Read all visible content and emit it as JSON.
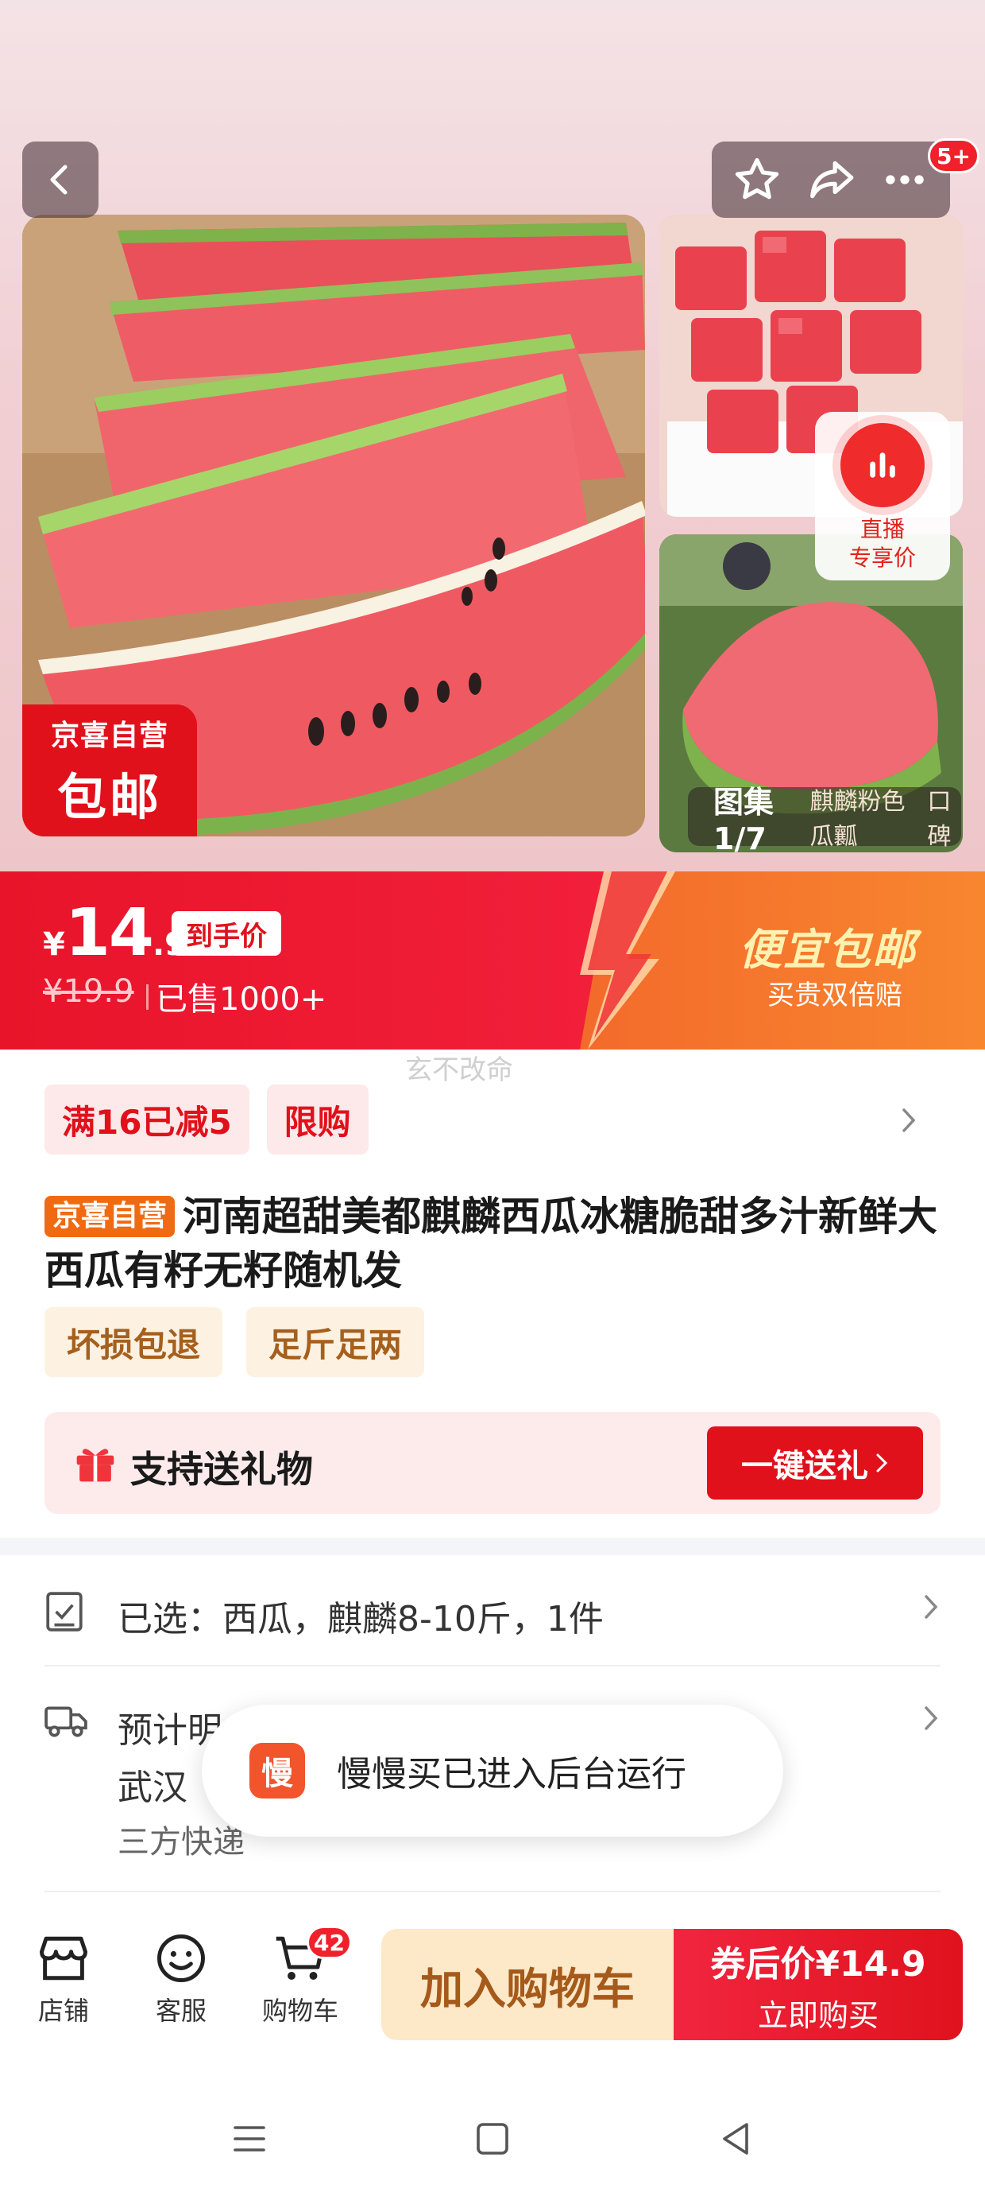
{
  "gallery": {
    "more_badge": "5+",
    "promo_tag_line1": "京喜自营",
    "promo_tag_line2": "包邮",
    "live_label_line1": "直播",
    "live_label_line2": "专享价",
    "counter": "图集1/7",
    "counter_sub": "麒麟粉色瓜瓤",
    "counter_extra": "口碑"
  },
  "price": {
    "currency": "¥",
    "integer": "14",
    "decimal": ".9",
    "tag": "到手价",
    "original": "¥19.9",
    "sold": "已售1000+",
    "promo_title": "便宜包邮",
    "promo_sub": "买贵双倍赔"
  },
  "watermark": "玄不改命",
  "promos": [
    "满16已减5",
    "限购"
  ],
  "product": {
    "badge": "京喜自营",
    "title": "河南超甜美都麒麟西瓜冰糖脆甜多汁新鲜大西瓜有籽无籽随机发"
  },
  "features": [
    "坏损包退",
    "足斤足两"
  ],
  "gift": {
    "label": "支持送礼物",
    "button": "一键送礼"
  },
  "selection": {
    "text": "已选：西瓜，麒麟8-10斤，1件"
  },
  "shipping": {
    "line1": "预计明",
    "line2": "武汉",
    "line3": "三方快递"
  },
  "toast": {
    "logo": "慢",
    "text": "慢慢买已进入后台运行"
  },
  "bottom_nav": {
    "store": "店铺",
    "service": "客服",
    "cart": "购物车",
    "cart_count": "42",
    "add_to_cart": "加入购物车",
    "buy_price": "券后价¥14.9",
    "buy_now": "立即购买"
  },
  "colors": {
    "brand_red": "#e1111c",
    "orange": "#f8862f",
    "gold_text": "#a55a1b"
  }
}
